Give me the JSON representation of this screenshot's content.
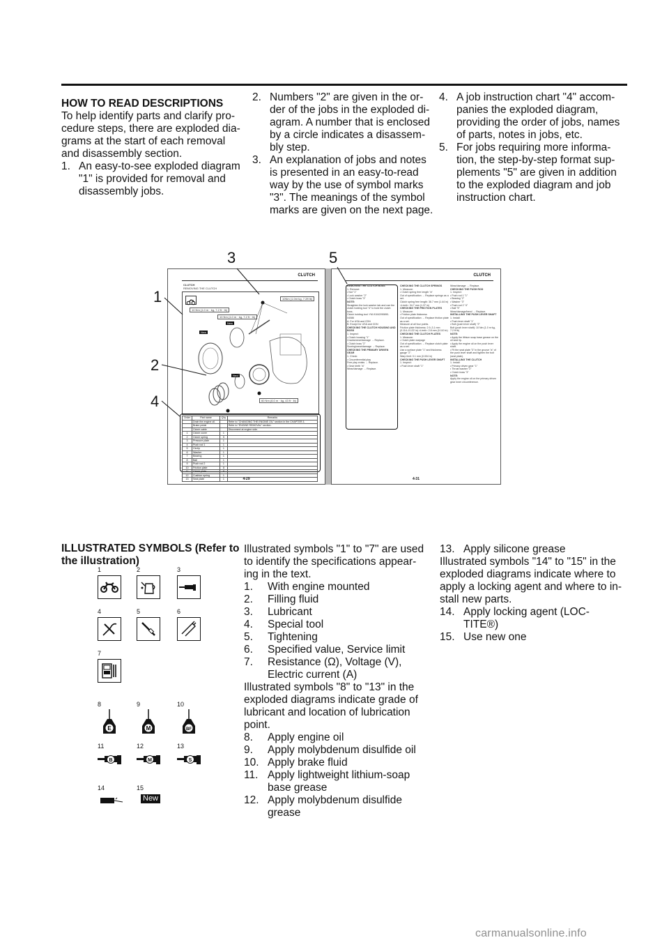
{
  "intro": {
    "heading": "HOW TO READ DESCRIPTIONS",
    "para_lines": [
      "To help identify parts and clarify pro-",
      "cedure steps, there are exploded dia-",
      "grams at the start of each removal",
      "and disassembly section."
    ],
    "items": [
      {
        "num": "1.",
        "lines": [
          "An easy-to-see exploded diagram",
          "\"1\" is provided for removal and",
          "disassembly jobs."
        ]
      },
      {
        "num": "2.",
        "lines": [
          "Numbers \"2\" are given in the or-",
          "der of the jobs in the exploded di-",
          "agram. A number that is enclosed",
          "by a circle indicates a disassem-",
          "bly step."
        ]
      },
      {
        "num": "3.",
        "lines": [
          "An explanation of jobs and notes",
          "is presented in an easy-to-read",
          "way by the use of symbol marks",
          "\"3\". The meanings of the symbol",
          "marks are given on the next page."
        ]
      },
      {
        "num": "4.",
        "lines": [
          "A job instruction chart \"4\" accom-",
          "panies the exploded diagram,",
          "providing the order of jobs, names",
          "of parts, notes in jobs, etc."
        ]
      },
      {
        "num": "5.",
        "lines": [
          "For jobs requiring more informa-",
          "tion, the step-by-step format sup-",
          "plements \"5\" are given in addition",
          "to the exploded diagram and job",
          "instruction chart."
        ]
      }
    ]
  },
  "figure": {
    "callouts": [
      "1",
      "2",
      "3",
      "4",
      "5"
    ],
    "left_page": {
      "header": "CLUTCH",
      "section": "CLUTCH",
      "subsection": "REMOVING THE CLUTCH",
      "torques": [
        "10 Nm (1.0 m · kg, 7.2 ft · lb)",
        "10 Nm (1.0 m · kg, 7.2 ft · lb)",
        "10Nm (1.0m·kg, 7.2ft·lb)",
        "60 Nm (6.0 m · kg, 43 ft · lb)"
      ],
      "new_label": "New",
      "table_headers": [
        "Order",
        "Part name",
        "Q'ty",
        "Remarks"
      ],
      "table_rows": [
        [
          "",
          "Drain the engine oil.",
          "",
          "Refer to \"CHANGING THE ENGINE OIL\" section in the CHAPTER 3."
        ],
        [
          "",
          "Brake pedal",
          "",
          "Refer to \"ENGINE REMOVAL\" section."
        ],
        [
          "",
          "Clutch cable",
          "",
          "Disconnect at engine side."
        ],
        [
          "1",
          "Clutch cover",
          "1",
          ""
        ],
        [
          "2",
          "Clutch spring",
          "5",
          ""
        ],
        [
          "3",
          "Pressure plate",
          "1",
          ""
        ],
        [
          "4",
          "Push rod 1",
          "1",
          ""
        ],
        [
          "5",
          "Circlip",
          "1",
          ""
        ],
        [
          "6",
          "Washer",
          "1",
          ""
        ],
        [
          "7",
          "Bearing",
          "1",
          ""
        ],
        [
          "8",
          "Ball",
          "1",
          ""
        ],
        [
          "9",
          "Push rod 2",
          "1",
          ""
        ],
        [
          "10",
          "Friction plate",
          "8",
          ""
        ],
        [
          "11",
          "Clutch plate",
          "8",
          ""
        ],
        [
          "12",
          "Cushion spring",
          "1",
          ""
        ],
        [
          "13",
          "Seat plate",
          "1",
          ""
        ]
      ],
      "page_number": "4-29"
    },
    "right_page": {
      "header": "CLUTCH",
      "col1": [
        "REMOVING THE CLUTCH BOSS",
        "1. Remove:",
        "• Nut \"1\"",
        "• Lock washer \"2\"",
        "• Clutch boss \"3\"",
        "NOTE:",
        "Straighten the lock washer tab and use the clutch holding tool \"4\" to hold the clutch boss.",
        "Clutch holding tool: YM-91042/90890-04086",
        "A. For USA and CDN",
        "B. Except for USA and CDN",
        "CHECKING THE CLUTCH HOUSING AND BOSS",
        "1. Inspect:",
        "• Clutch housing \"1\"",
        "Cracks/wear/damage → Replace.",
        "• Clutch boss \"2\"",
        "Scoring/wear/damage → Replace.",
        "CHECKING THE PRIMARY DRIVEN GEAR",
        "1. Check:",
        "• Circumferential play",
        "Free play exists → Replace.",
        "• Gear teeth \"a\"",
        "Wear/damage → Replace."
      ],
      "col2": [
        "CHECKING THE CLUTCH SPRINGS",
        "1. Measure:",
        "• Clutch spring free length \"a\"",
        "Out of specification → Replace springs as a set.",
        "Clutch spring free length: 36.7 mm (1.44 in) <Limit>: 34.7 mm (1.37 in)",
        "CHECKING THE FRICTION PLATES",
        "1. Measure:",
        "• Friction plate thickness",
        "Out of specification → Replace friction plate as a set.",
        "Measure at all four points.",
        "Friction plate thickness: 2.9–3.1 mm (0.114–0.122 in) <Limit>: 2.8 mm (0.110 in)",
        "CHECKING THE CLUTCH PLATES",
        "1. Measure:",
        "• Clutch plate warpage",
        "Out of specification → Replace clutch plate as a set.",
        "Use a surface plate \"1\" and thickness gauge \"2\".",
        "Warp limit: 0.1 mm (0.004 in)",
        "CHECKING THE PUSH LEVER SHAFT",
        "1. Inspect:",
        "• Push lever shaft \"1\""
      ],
      "col3": [
        "Wear/damage → Replace.",
        "CHECKING THE PUSH ROD",
        "1. Inspect:",
        "• Push rod 1 \"1\"",
        "• Bearing \"2\"",
        "• Washer \"3\"",
        "• Push rod 2 \"4\"",
        "• Ball \"5\"",
        "Wear/damage/bend → Replace.",
        "INSTALLING THE PUSH LEVER SHAFT",
        "1. Install:",
        "• Push lever shaft \"1\"",
        "• Bolt (push lever shaft) \"2\"",
        "Bolt (push lever shaft): 10 Nm (1.0 m·kg, 7.2 ft·lb)",
        "NOTE:",
        "• Apply the lithium soap base grease on the oil seal lip.",
        "• Apply the engine oil on the push lever shaft.",
        "• Fit the seat plate \"3\" in the groove \"a\" of the push lever shaft and tighten the bolt (seat plate).",
        "INSTALLING THE CLUTCH",
        "1. Install:",
        "• Primary driven gear \"1\"",
        "• Thrust washer \"2\"",
        "• Clutch boss \"3\"",
        "NOTE:",
        "Apply the engine oil on the primary driven gear inner circumference."
      ],
      "page_number": "4-31"
    }
  },
  "symbols_section": {
    "heading_lines": [
      "ILLUSTRATED SYMBOLS (Refer to",
      "the illustration)"
    ],
    "icons": [
      {
        "num": "1",
        "icon": "motorcycle-icon"
      },
      {
        "num": "2",
        "icon": "oil-can-icon"
      },
      {
        "num": "3",
        "icon": "grease-gun-icon"
      },
      {
        "num": "4",
        "icon": "special-tool-icon"
      },
      {
        "num": "5",
        "icon": "torque-wrench-icon"
      },
      {
        "num": "6",
        "icon": "caliper-icon"
      },
      {
        "num": "7",
        "icon": "multimeter-icon"
      },
      {
        "num": "8",
        "icon": "oil-bottle-icon",
        "letter": "E"
      },
      {
        "num": "9",
        "icon": "oil-bottle-icon",
        "letter": "M"
      },
      {
        "num": "10",
        "icon": "oil-bottle-icon",
        "letter": "BF"
      },
      {
        "num": "11",
        "icon": "grease-gun-icon",
        "letter": "B"
      },
      {
        "num": "12",
        "icon": "grease-gun-icon",
        "letter": "M"
      },
      {
        "num": "13",
        "icon": "grease-gun-icon",
        "letter": "S"
      },
      {
        "num": "14",
        "icon": "locking-agent-icon"
      },
      {
        "num": "15",
        "icon": "new-part-icon",
        "label": "New"
      }
    ],
    "para1_lines": [
      "Illustrated symbols \"1\" to \"7\" are used",
      "to identify the specifications appear-",
      "ing in the text."
    ],
    "list1": [
      {
        "num": "1.",
        "lines": [
          "With engine mounted"
        ]
      },
      {
        "num": "2.",
        "lines": [
          "Filling fluid"
        ]
      },
      {
        "num": "3.",
        "lines": [
          "Lubricant"
        ]
      },
      {
        "num": "4.",
        "lines": [
          "Special tool"
        ]
      },
      {
        "num": "5.",
        "lines": [
          "Tightening"
        ]
      },
      {
        "num": "6.",
        "lines": [
          "Specified value, Service limit"
        ]
      },
      {
        "num": "7.",
        "lines": [
          "Resistance (Ω), Voltage (V),",
          "Electric current (A)"
        ]
      }
    ],
    "para2_lines": [
      "Illustrated symbols \"8\" to \"13\" in the",
      "exploded diagrams indicate grade of",
      "lubricant and location of lubrication",
      "point."
    ],
    "list2": [
      {
        "num": "8.",
        "lines": [
          "Apply engine oil"
        ]
      },
      {
        "num": "9.",
        "lines": [
          "Apply molybdenum disulfide oil"
        ]
      },
      {
        "num": "10.",
        "lines": [
          "Apply brake fluid"
        ]
      },
      {
        "num": "11.",
        "lines": [
          "Apply lightweight lithium-soap",
          "base grease"
        ]
      },
      {
        "num": "12.",
        "lines": [
          "Apply molybdenum disulfide",
          "grease"
        ]
      },
      {
        "num": "13.",
        "lines": [
          "Apply silicone grease"
        ]
      }
    ],
    "para3_lines": [
      "Illustrated symbols \"14\" to \"15\" in the",
      "exploded diagrams indicate where to",
      "apply a locking agent and where to in-",
      "stall new parts."
    ],
    "list3": [
      {
        "num": "14.",
        "lines": [
          "Apply locking agent (LOC-",
          "TITE®)"
        ]
      },
      {
        "num": "15.",
        "lines": [
          "Use new one"
        ]
      }
    ]
  },
  "watermark": "carmanualsonline.info"
}
